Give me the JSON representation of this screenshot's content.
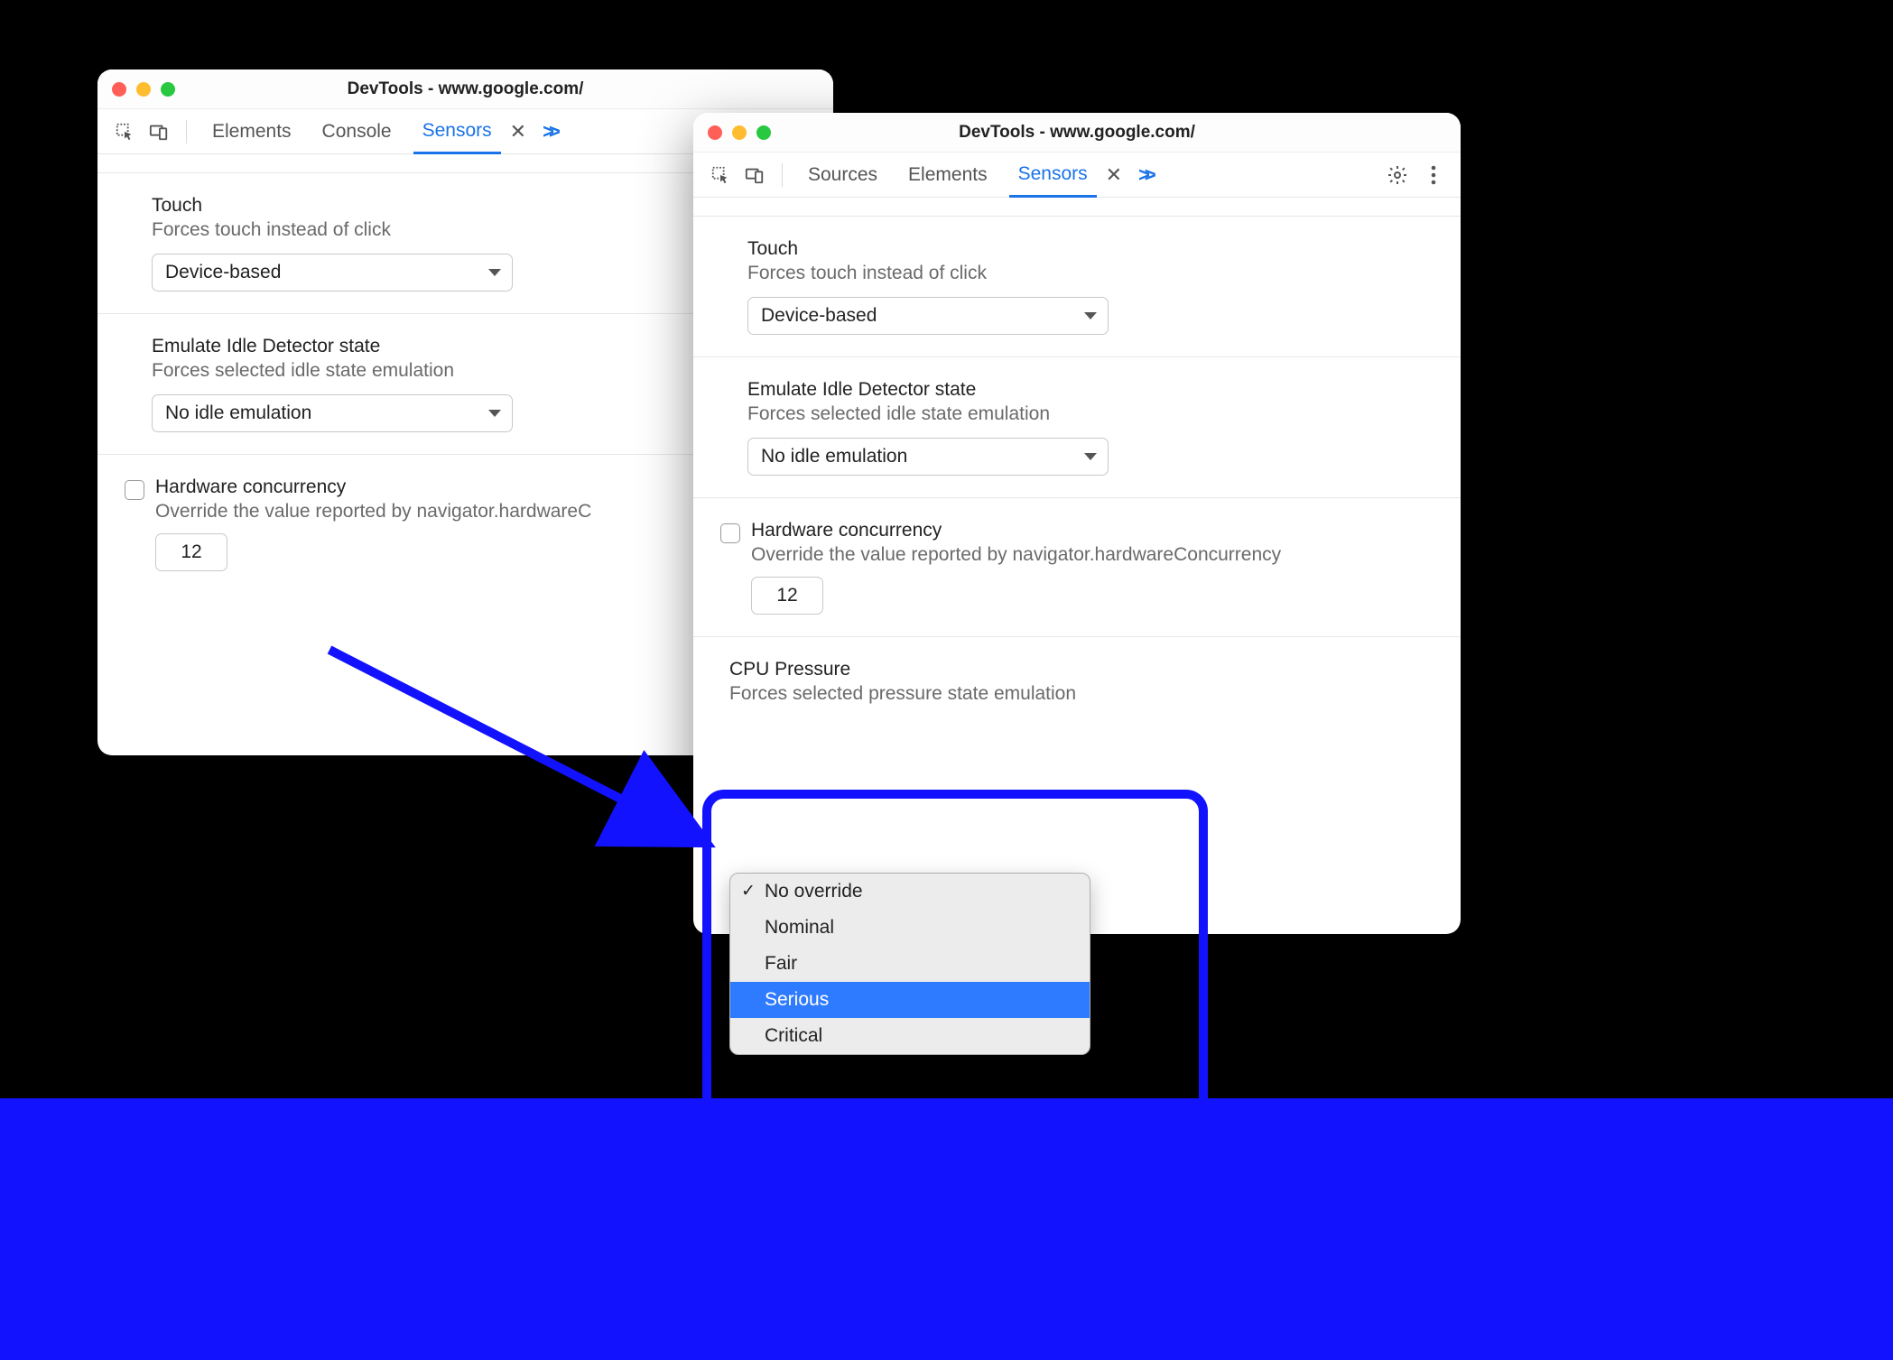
{
  "windowLeft": {
    "title": "DevTools - www.google.com/",
    "tabs": {
      "t1": "Elements",
      "t2": "Console",
      "t3": "Sensors"
    },
    "touch": {
      "heading": "Touch",
      "desc": "Forces touch instead of click",
      "value": "Device-based"
    },
    "idle": {
      "heading": "Emulate Idle Detector state",
      "desc": "Forces selected idle state emulation",
      "value": "No idle emulation"
    },
    "hw": {
      "heading": "Hardware concurrency",
      "desc": "Override the value reported by navigator.hardwareC",
      "value": "12"
    }
  },
  "windowRight": {
    "title": "DevTools - www.google.com/",
    "tabs": {
      "t1": "Sources",
      "t2": "Elements",
      "t3": "Sensors"
    },
    "touch": {
      "heading": "Touch",
      "desc": "Forces touch instead of click",
      "value": "Device-based"
    },
    "idle": {
      "heading": "Emulate Idle Detector state",
      "desc": "Forces selected idle state emulation",
      "value": "No idle emulation"
    },
    "hw": {
      "heading": "Hardware concurrency",
      "desc": "Override the value reported by navigator.hardwareConcurrency",
      "value": "12"
    },
    "cpu": {
      "heading": "CPU Pressure",
      "desc": "Forces selected pressure state emulation",
      "options": {
        "o1": "No override",
        "o2": "Nominal",
        "o3": "Fair",
        "o4": "Serious",
        "o5": "Critical"
      }
    }
  }
}
